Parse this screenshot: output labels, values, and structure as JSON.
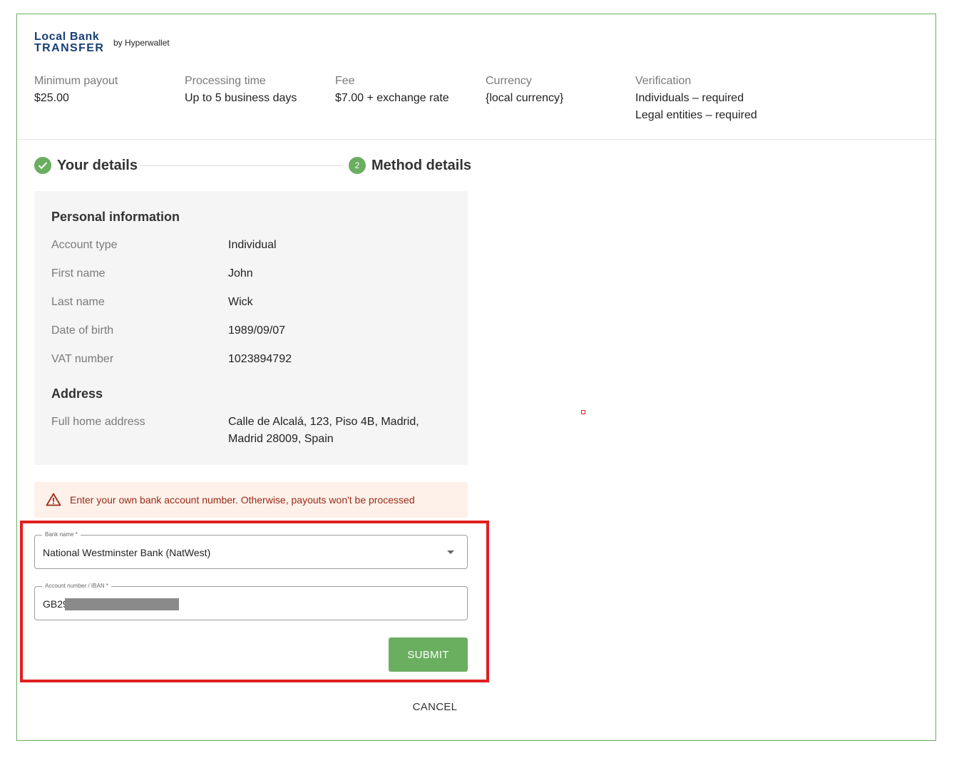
{
  "logo": {
    "line1": "Local Bank",
    "line2": "TRANSFER",
    "by": "by Hyperwallet"
  },
  "info": [
    {
      "label": "Minimum payout",
      "value": "$25.00"
    },
    {
      "label": "Processing time",
      "value": "Up to 5 business days"
    },
    {
      "label": "Fee",
      "value": "$7.00 + exchange rate"
    },
    {
      "label": "Currency",
      "value": "{local currency}"
    },
    {
      "label": "Verification",
      "value": "Individuals – required",
      "value2": "Legal entities – required"
    }
  ],
  "stepper": {
    "step1": {
      "label": "Your details",
      "status": "completed",
      "icon": "check-icon"
    },
    "step2": {
      "number": "2",
      "label": "Method details",
      "status": "active"
    }
  },
  "personal": {
    "heading": "Personal information",
    "rows": [
      {
        "label": "Account type",
        "value": "Individual"
      },
      {
        "label": "First name",
        "value": "John"
      },
      {
        "label": "Last name",
        "value": "Wick"
      },
      {
        "label": "Date of birth",
        "value": "1989/09/07"
      },
      {
        "label": "VAT number",
        "value": "1023894792"
      }
    ],
    "address_heading": "Address",
    "address_label": "Full home address",
    "address_line1": "Calle de Alcalá, 123, Piso 4B, Madrid,",
    "address_line2": "Madrid 28009, Spain"
  },
  "warning": {
    "icon": "warning-triangle-icon",
    "text": "Enter your own bank account number. Otherwise, payouts won't be processed"
  },
  "form": {
    "bank_name_label": "Bank name *",
    "bank_name_value": "National Westminster Bank (NatWest)",
    "account_label": "Account number / IBAN *",
    "account_value": "GB29",
    "submit_label": "SUBMIT",
    "cancel_label": "CANCEL"
  },
  "colors": {
    "accent": "#6aae5f",
    "brand": "#173e75",
    "warning_bg": "#fdf1e9",
    "warning_text": "#9a2a1a",
    "highlight": "#e02020"
  }
}
